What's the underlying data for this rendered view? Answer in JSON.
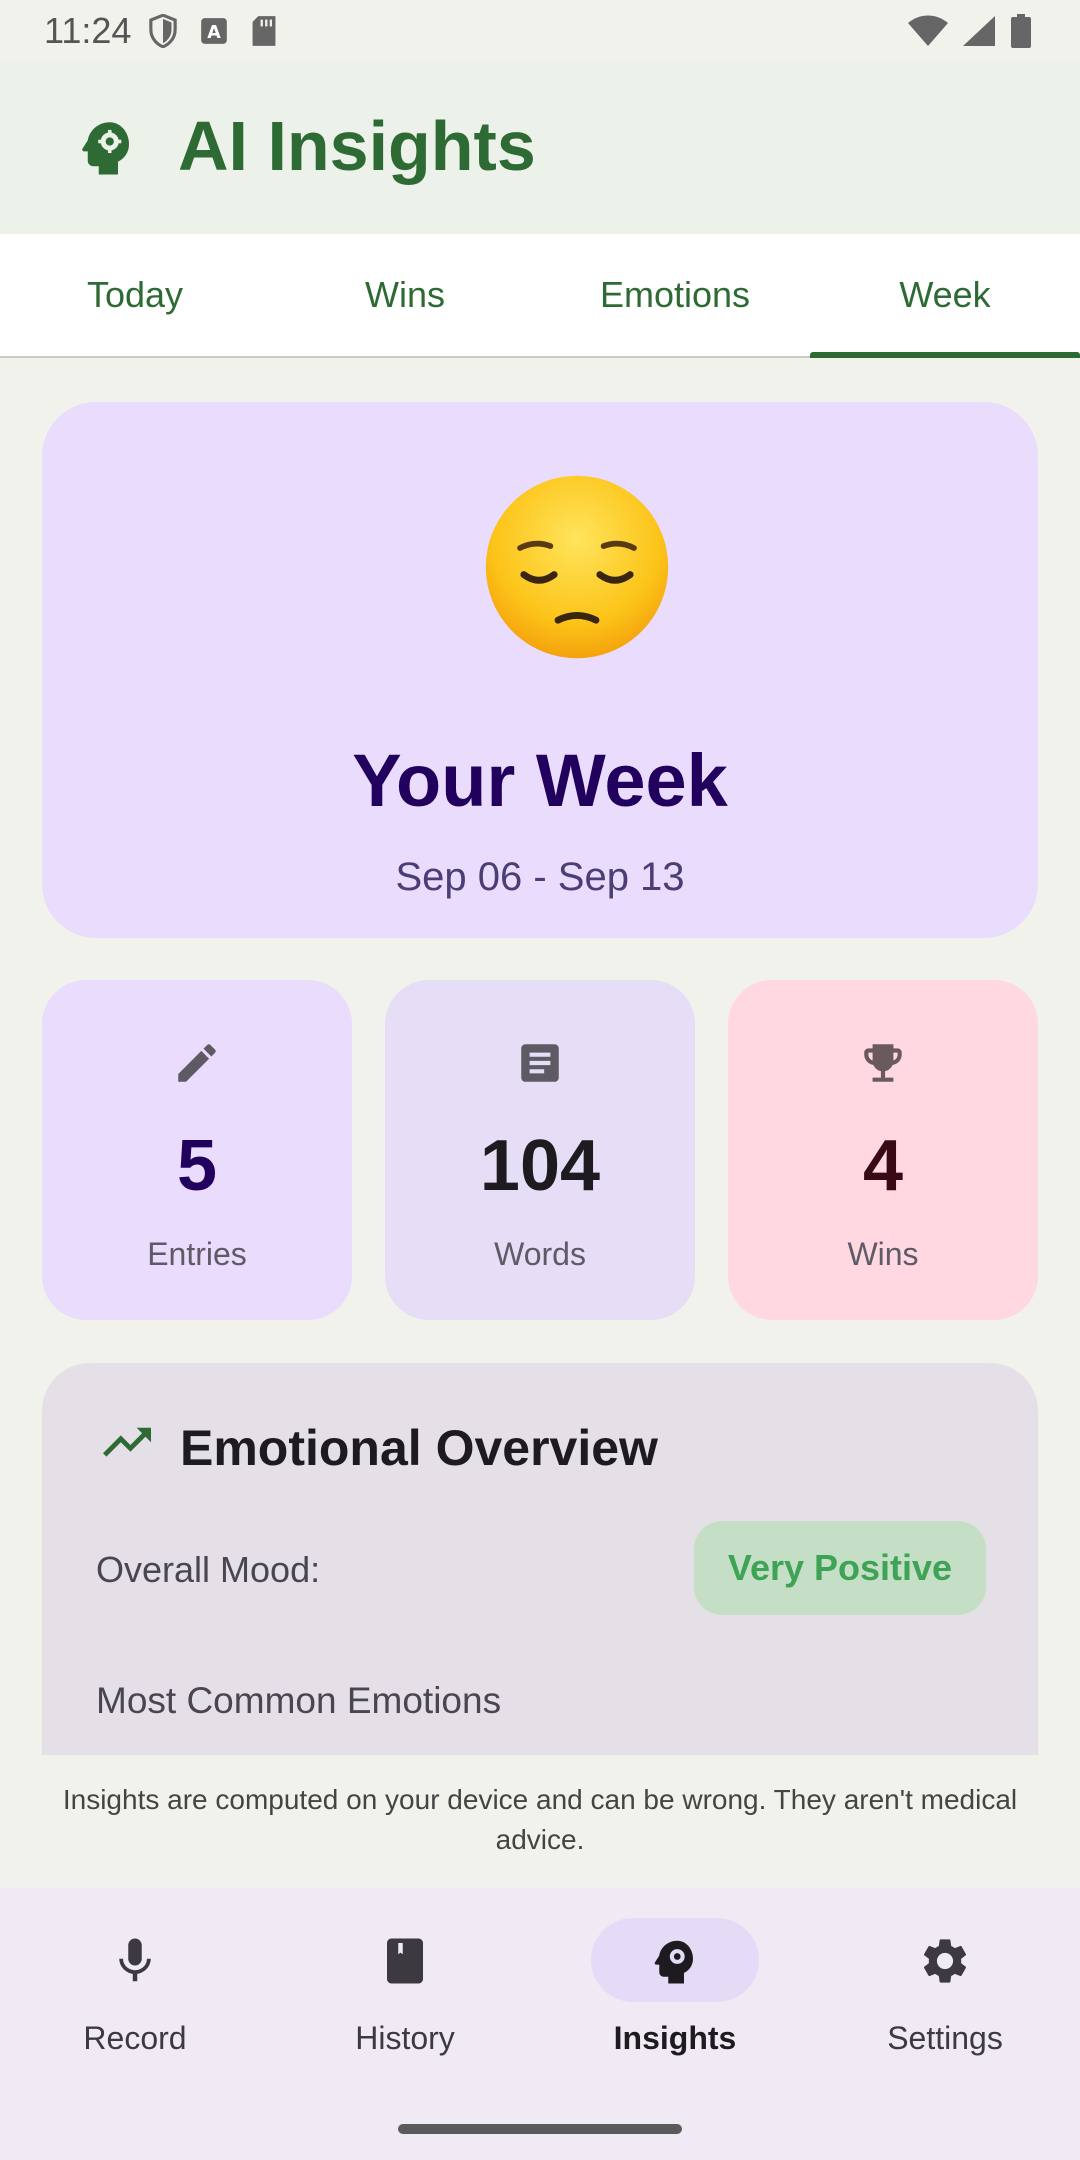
{
  "status_bar": {
    "time": "11:24",
    "icons_left": [
      "shield-icon",
      "keyboard-a-icon",
      "sd-card-icon"
    ],
    "icons_right": [
      "wifi-icon",
      "signal-icon",
      "battery-icon"
    ]
  },
  "app_bar": {
    "title": "AI Insights",
    "icon": "psychology-icon"
  },
  "tabs": [
    {
      "label": "Today",
      "active": false
    },
    {
      "label": "Wins",
      "active": false
    },
    {
      "label": "Emotions",
      "active": false
    },
    {
      "label": "Week",
      "active": true
    }
  ],
  "week_summary": {
    "emoji": "pensive-face",
    "title": "Your Week",
    "date_range": "Sep 06 - Sep 13"
  },
  "stats": [
    {
      "icon": "pencil-icon",
      "value": "5",
      "label": "Entries"
    },
    {
      "icon": "article-icon",
      "value": "104",
      "label": "Words"
    },
    {
      "icon": "trophy-icon",
      "value": "4",
      "label": "Wins"
    }
  ],
  "emotional_overview": {
    "icon": "trending-up-icon",
    "title": "Emotional Overview",
    "mood_label": "Overall Mood:",
    "mood_value": "Very Positive",
    "common_emotions_heading": "Most Common Emotions"
  },
  "disclaimer": "Insights are computed on your device and can be wrong. They aren't medical advice.",
  "bottom_nav": [
    {
      "label": "Record",
      "icon": "mic-icon",
      "active": false
    },
    {
      "label": "History",
      "icon": "book-icon",
      "active": false
    },
    {
      "label": "Insights",
      "icon": "psychology-icon",
      "active": true
    },
    {
      "label": "Settings",
      "icon": "gear-icon",
      "active": false
    }
  ],
  "colors": {
    "brand_green": "#2e6b34",
    "card_lavender": "#eadcfd",
    "card_pink": "#ffd8e2",
    "mood_positive": "#3fa356"
  }
}
